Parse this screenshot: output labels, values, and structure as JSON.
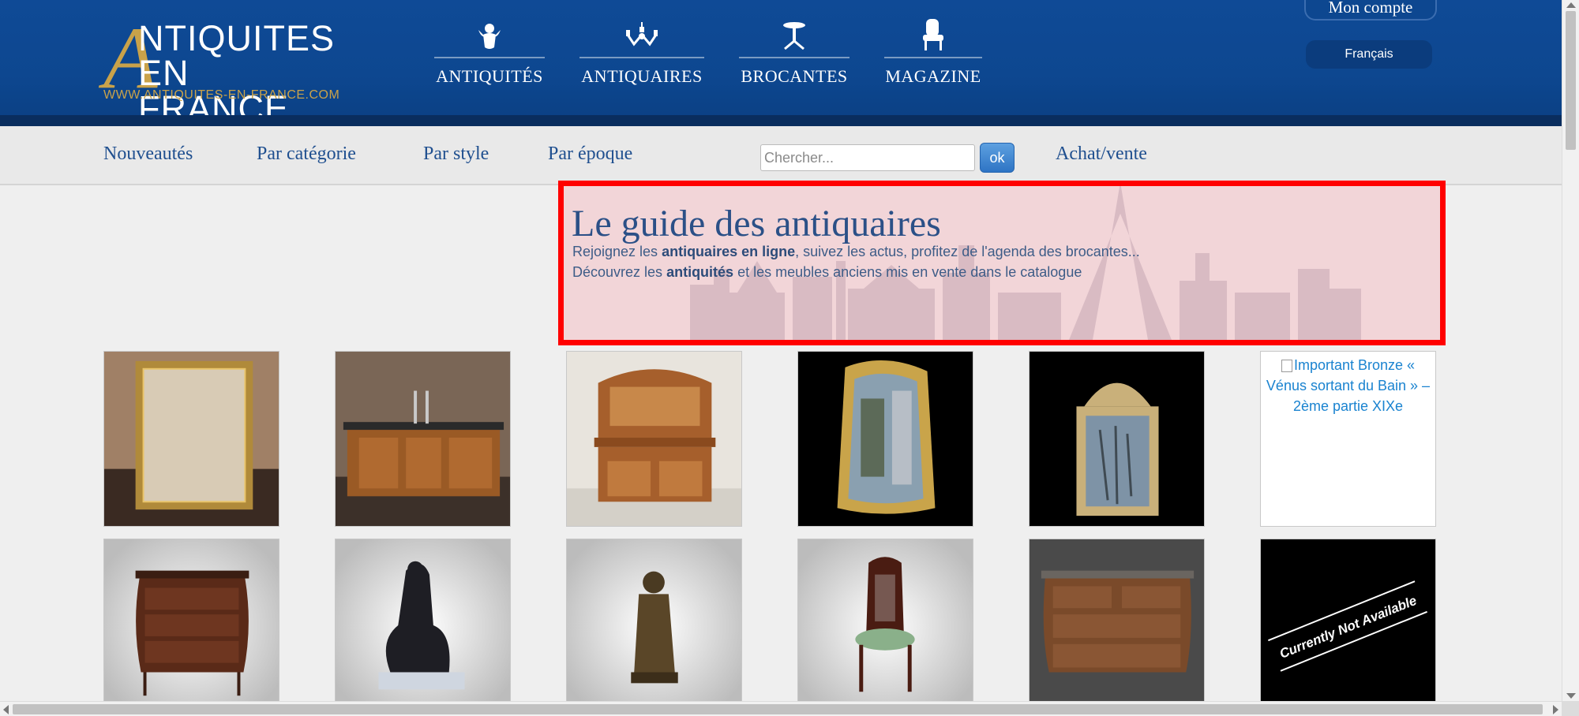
{
  "colors": {
    "header_blue": "#0d4790",
    "gold": "#c9a24a",
    "link_blue": "#1f4f8f",
    "highlight_red": "#ff0000",
    "hero_pink": "#f2d5d8"
  },
  "logo": {
    "line1": "NTIQUITES",
    "line2": "EN FRANCE",
    "url": "WWW.ANTIQUITES-EN-FRANCE.COM"
  },
  "main_nav": [
    {
      "label": "ANTIQUITÉS",
      "icon": "cherub-icon"
    },
    {
      "label": "ANTIQUAIRES",
      "icon": "chandelier-icon"
    },
    {
      "label": "BROCANTES",
      "icon": "pedestal-table-icon"
    },
    {
      "label": "MAGAZINE",
      "icon": "armchair-icon"
    }
  ],
  "account": {
    "label": "Mon compte"
  },
  "language": {
    "label": "Français"
  },
  "sub_nav": {
    "items": [
      "Nouveautés",
      "Par catégorie",
      "Par style",
      "Par époque"
    ],
    "search_placeholder": "Chercher...",
    "search_button": "ok",
    "buy_sell": "Achat/vente"
  },
  "hero": {
    "title": "Le guide des antiquaires",
    "line1": {
      "pre": "Rejoignez les ",
      "bold": "antiquaires en ligne",
      "post": ", suivez les actus, profitez de l'agenda des brocantes..."
    },
    "line2": {
      "pre": "Découvrez les ",
      "bold": "antiquités",
      "post": " et les meubles anciens mis en vente dans le catalogue"
    }
  },
  "products": {
    "row1": [
      {
        "name": "gilded-mirror"
      },
      {
        "name": "wooden-sink-cabinet"
      },
      {
        "name": "art-nouveau-buffet"
      },
      {
        "name": "carved-mirror-black"
      },
      {
        "name": "louis-xvi-mirror"
      },
      {
        "name": "broken-image",
        "alt": "Important Bronze « Vénus sortant du Bain » – 2ème partie XIXe"
      }
    ],
    "row2": [
      {
        "name": "louis-xv-commode"
      },
      {
        "name": "bronze-group-sculpture"
      },
      {
        "name": "bronze-statuette"
      },
      {
        "name": "carved-chair"
      },
      {
        "name": "marble-top-commode"
      },
      {
        "name": "not-available",
        "text": "Currently Not Available"
      }
    ]
  }
}
